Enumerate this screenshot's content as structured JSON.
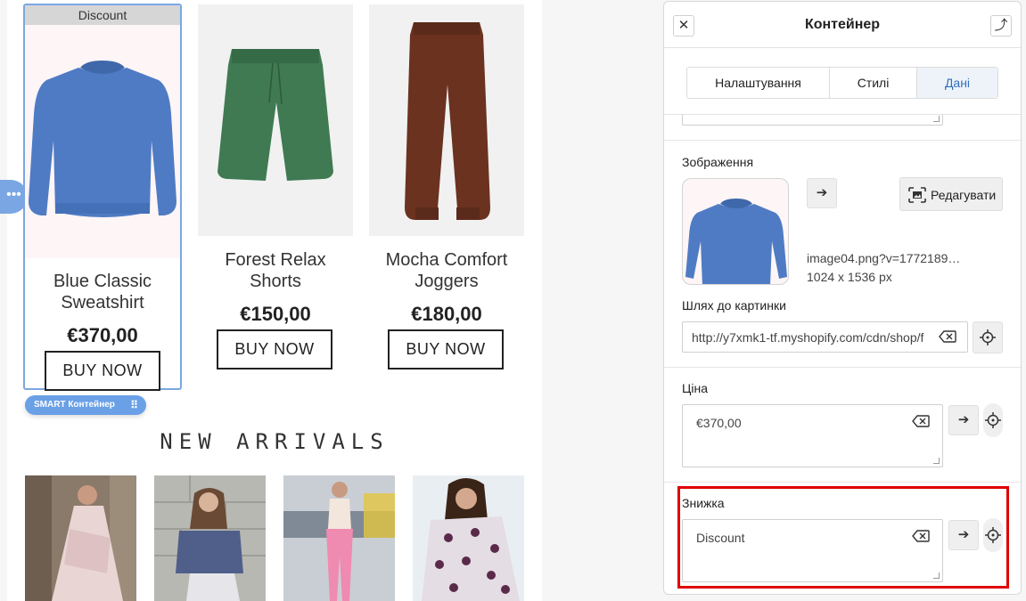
{
  "store": {
    "products": [
      {
        "badge": "Discount",
        "name": "Blue Classic Sweatshirt",
        "price": "€370,00",
        "buy_label": "BUY NOW"
      },
      {
        "name": "Forest Relax Shorts",
        "price": "€150,00",
        "buy_label": "BUY NOW"
      },
      {
        "name": "Mocha Comfort Joggers",
        "price": "€180,00",
        "buy_label": "BUY NOW"
      }
    ],
    "smart_tag": "SMART Контейнер",
    "section_heading": "NEW ARRIVALS"
  },
  "panel": {
    "title": "Контейнер",
    "close_icon": "close-icon",
    "pin_icon": "pin-icon",
    "tabs": [
      {
        "label": "Налаштування",
        "active": false
      },
      {
        "label": "Стилі",
        "active": false
      },
      {
        "label": "Дані",
        "active": true
      }
    ],
    "image_section": {
      "label": "Зображення",
      "edit_label": "Редагувати",
      "file_name": "image04.png?v=1772189…",
      "dimensions": "1024 x 1536 px"
    },
    "path_section": {
      "label": "Шлях до картинки",
      "value": "http://y7xmk1-tf.myshopify.com/cdn/shop/f"
    },
    "price_section": {
      "label": "Ціна",
      "value": "€370,00"
    },
    "discount_section": {
      "label": "Знижка",
      "value": "Discount"
    }
  },
  "colors": {
    "selection": "#7aa7e3",
    "active_tab": "#2f6fbd",
    "highlight": "#e00000"
  }
}
